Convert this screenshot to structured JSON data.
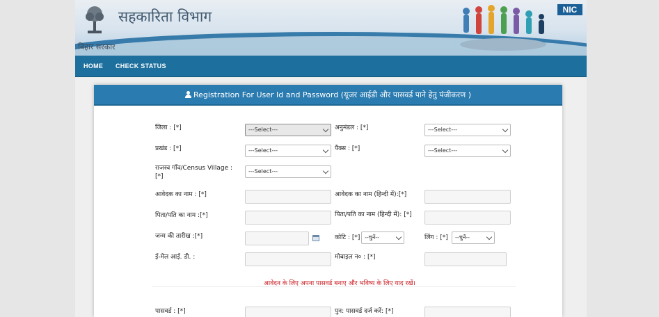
{
  "header": {
    "dept_title": "सहकारिता विभाग",
    "govt_text": "बिहार सरकार",
    "nic_logo": "NIC",
    "logo_icon": "tree-emblem-icon",
    "people_graphic": "people-montage-icon"
  },
  "nav": {
    "home": "HOME",
    "check_status": "CHECK STATUS"
  },
  "form": {
    "title": "Registration For User Id and Password (यूजर आईडी और पासवर्ड पाने हेतु पंजीकरण )",
    "labels": {
      "district": "जिला : [*]",
      "subdivision": "अनुमंडल : [*]",
      "block": "प्रखंड : [*]",
      "pacs": "पैक्स : [*]",
      "village": "राजस्व गाँव/Census Village :[*]",
      "applicant_name": "आवेदक का नाम : [*]",
      "applicant_name_hindi": "आवेदक का नाम (हिन्दी में):[*]",
      "father_name": "पिता/पति का नाम :[*]",
      "father_name_hindi": "पिता/पति का नाम (हिन्दी में): [*]",
      "dob": "जन्म की तारीख :[*]",
      "category": "कोटि : [*]",
      "gender": "लिंग : [*]",
      "email": "ई-मेल आई. डी. :",
      "mobile": "मोबाइल न० : [*]",
      "password": "पासवर्ड : [*]",
      "confirm_password": "पुन: पासवर्ड दर्ज करें: [*]"
    },
    "selects": {
      "district": "---Select---",
      "subdivision": "---Select---",
      "block": "---Select---",
      "pacs": "---Select---",
      "village": "---Select---",
      "category": "--चुनें--",
      "gender": "--चुनें--"
    },
    "inputs": {
      "applicant_name": "",
      "applicant_name_hindi": "",
      "father_name": "",
      "father_name_hindi": "",
      "dob": "",
      "email": "",
      "mobile": "",
      "password": "",
      "confirm_password": ""
    },
    "note": "आवेदन के लिए अपना पासवर्ड बनाए और भविष्य के लिए याद रखें।"
  },
  "colors": {
    "nav": "#1d6f9d",
    "panel_header": "#2a7bb0",
    "note": "#c8141a"
  }
}
